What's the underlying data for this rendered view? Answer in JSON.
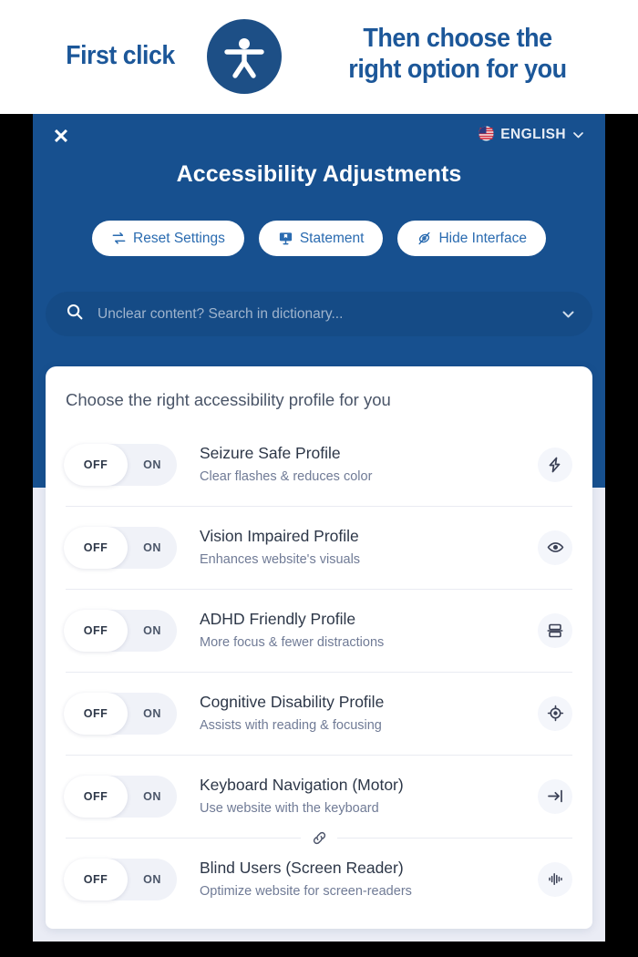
{
  "banner": {
    "left_text": "First click",
    "right_text_line1": "Then choose the",
    "right_text_line2": "right option for you",
    "logo_icon": "accessibility-person-icon",
    "text_color": "#1c5799",
    "logo_color": "#1d4f86"
  },
  "widget": {
    "close_label": "✕",
    "language": {
      "flag_icon": "us-flag-icon",
      "flag_glyph": "🇺🇸",
      "label": "ENGLISH",
      "chevron": "⌄"
    },
    "title": "Accessibility Adjustments",
    "header_color": "#17508f",
    "buttons": [
      {
        "label": "Reset Settings",
        "icon": "reset-arrows-icon"
      },
      {
        "label": "Statement",
        "icon": "statement-monitor-icon"
      },
      {
        "label": "Hide Interface",
        "icon": "hide-eye-icon"
      }
    ],
    "search": {
      "icon": "search-icon",
      "placeholder": "Unclear content? Search in dictionary...",
      "chevron": "⌄"
    }
  },
  "card": {
    "title": "Choose the right accessibility profile for you",
    "toggle": {
      "off_label": "OFF",
      "on_label": "ON",
      "state": "OFF"
    },
    "divider_chip_icon": "link-chain-icon",
    "profiles": [
      {
        "name": "Seizure Safe Profile",
        "desc": "Clear flashes & reduces color",
        "icon": "lightning-bolt-icon",
        "state": "OFF"
      },
      {
        "name": "Vision Impaired Profile",
        "desc": "Enhances website's visuals",
        "icon": "eye-icon",
        "state": "OFF"
      },
      {
        "name": "ADHD Friendly Profile",
        "desc": "More focus & fewer distractions",
        "icon": "layout-rows-icon",
        "state": "OFF"
      },
      {
        "name": "Cognitive Disability Profile",
        "desc": "Assists with reading & focusing",
        "icon": "target-crosshair-icon",
        "state": "OFF"
      },
      {
        "name": "Keyboard Navigation (Motor)",
        "desc": "Use website with the keyboard",
        "icon": "arrow-to-bar-icon",
        "state": "OFF"
      },
      {
        "name": "Blind Users (Screen Reader)",
        "desc": "Optimize website for screen-readers",
        "icon": "audio-waveform-icon",
        "state": "OFF"
      }
    ]
  }
}
